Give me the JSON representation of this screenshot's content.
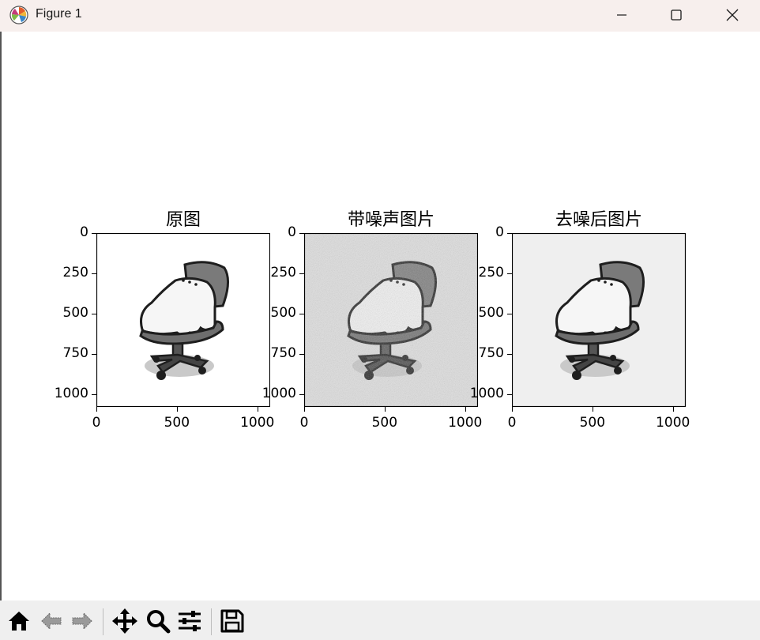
{
  "window": {
    "title": "Figure 1",
    "app_icon": "matplotlib-icon",
    "controls": [
      "minimize-icon",
      "maximize-icon",
      "close-icon"
    ]
  },
  "figure": {
    "axes": [
      {
        "title": "原图",
        "image": "chair-grayscale-original",
        "background": "#ffffff",
        "y_ticks": [
          "0",
          "250",
          "500",
          "750",
          "1000"
        ],
        "x_ticks": [
          "0",
          "500",
          "1000"
        ]
      },
      {
        "title": "带噪声图片",
        "image": "chair-grayscale-noisy",
        "background": "#e2e2e2",
        "y_ticks": [
          "0",
          "250",
          "500",
          "750",
          "1000"
        ],
        "x_ticks": [
          "0",
          "500",
          "1000"
        ]
      },
      {
        "title": "去噪后图片",
        "image": "chair-grayscale-denoised",
        "background": "#efefef",
        "y_ticks": [
          "0",
          "250",
          "500",
          "750",
          "1000"
        ],
        "x_ticks": [
          "0",
          "500",
          "1000"
        ]
      }
    ]
  },
  "toolbar": {
    "buttons": [
      {
        "name": "home-icon"
      },
      {
        "name": "back-arrow-icon"
      },
      {
        "name": "forward-arrow-icon"
      },
      {
        "name": "pan-move-icon"
      },
      {
        "name": "zoom-magnifier-icon"
      },
      {
        "name": "configure-subplots-icon"
      },
      {
        "name": "save-floppy-icon"
      }
    ]
  }
}
